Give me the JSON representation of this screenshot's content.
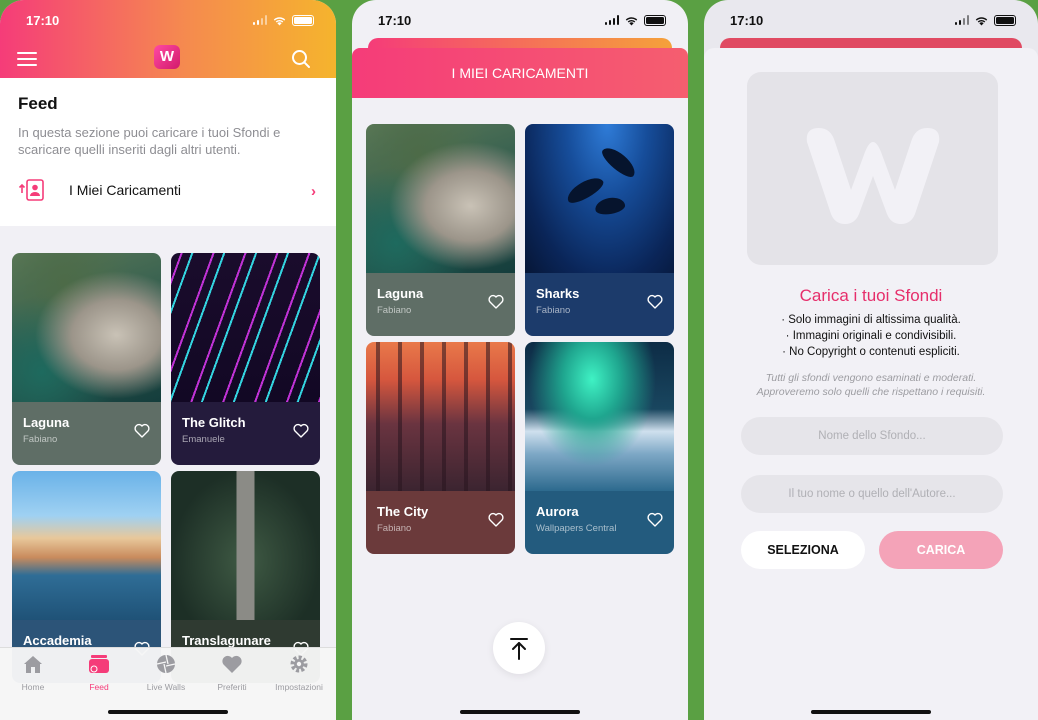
{
  "status": {
    "time": "17:10"
  },
  "screen_feed": {
    "title": "Feed",
    "description": "In questa sezione puoi caricare i tuoi Sfondi e scaricare quelli inseriti dagli altri utenti.",
    "my_uploads_label": "I Miei Caricamenti",
    "logo_letter": "W",
    "wallpapers": [
      {
        "name": "Laguna",
        "author": "Fabiano"
      },
      {
        "name": "The Glitch",
        "author": "Emanuele"
      },
      {
        "name": "Accademia",
        "author": ""
      },
      {
        "name": "Translagunare",
        "author": ""
      }
    ],
    "tabs": [
      {
        "label": "Home",
        "icon": "home-icon"
      },
      {
        "label": "Feed",
        "icon": "feed-icon"
      },
      {
        "label": "Live Walls",
        "icon": "aperture-icon"
      },
      {
        "label": "Preferiti",
        "icon": "heart-icon"
      },
      {
        "label": "Impostazioni",
        "icon": "gear-icon"
      }
    ],
    "active_tab": "Feed"
  },
  "screen_uploads": {
    "title": "I MIEI CARICAMENTI",
    "wallpapers": [
      {
        "name": "Laguna",
        "author": "Fabiano"
      },
      {
        "name": "Sharks",
        "author": "Fabiano"
      },
      {
        "name": "The City",
        "author": "Fabiano"
      },
      {
        "name": "Aurora",
        "author": "Wallpapers Central"
      }
    ]
  },
  "screen_upload_form": {
    "title": "Carica i tuoi Sfondi",
    "rules": [
      "· Solo immagini di altissima qualità.",
      "· Immagini originali e condivisibili.",
      "· No Copyright o contenuti espliciti."
    ],
    "note_line1": "Tutti gli sfondi vengono esaminati e moderati.",
    "note_line2": "Approveremo solo quelli che rispettano i requisiti.",
    "name_placeholder": "Nome dello Sfondo...",
    "author_placeholder": "Il tuo nome o quello dell'Autore...",
    "select_label": "SELEZIONA",
    "upload_label": "CARICA"
  },
  "colors": {
    "accent": "#f53c79",
    "gradient_end": "#f5b42d",
    "upload_disabled": "#f4a3b8"
  }
}
